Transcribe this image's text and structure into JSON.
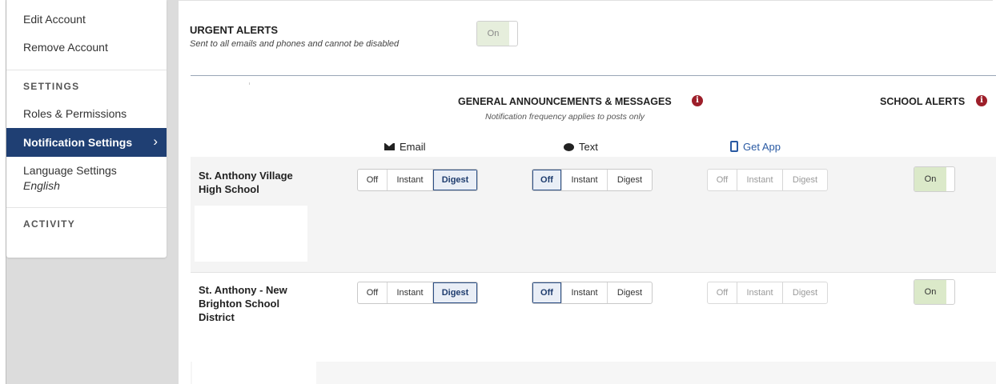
{
  "sidebar": {
    "edit_account": "Edit Account",
    "remove_account": "Remove Account",
    "settings_heading": "SETTINGS",
    "roles": "Roles & Permissions",
    "notification_settings": "Notification Settings",
    "chevron": "›",
    "language_settings": "Language Settings",
    "language_value": "English",
    "activity_heading": "ACTIVITY"
  },
  "urgent": {
    "title": "URGENT ALERTS",
    "subtitle": "Sent to all emails and phones and cannot be disabled",
    "toggle_label": "On"
  },
  "general": {
    "title": "GENERAL ANNOUNCEMENTS & MESSAGES",
    "subtitle": "Notification frequency applies to posts only",
    "info_glyph": "i"
  },
  "school_alerts": {
    "title": "SCHOOL ALERTS",
    "info_glyph": "i"
  },
  "columns": {
    "email": {
      "label": "Email",
      "icon": "envelope-icon"
    },
    "text": {
      "label": "Text",
      "icon": "chat-bubble-icon"
    },
    "app": {
      "label": "Get App",
      "icon": "mobile-phone-icon"
    }
  },
  "options": {
    "off": "Off",
    "instant": "Instant",
    "digest": "Digest",
    "on": "On"
  },
  "schools": [
    {
      "name": "St. Anthony Village High School",
      "email": "Digest",
      "text": "Off",
      "app": "disabled",
      "school_alerts": "On"
    },
    {
      "name": "St. Anthony - New Brighton School District",
      "email": "Digest",
      "text": "Off",
      "app": "disabled",
      "school_alerts": "On"
    }
  ],
  "colors": {
    "nav_active": "#1f3f73",
    "toggle_on": "#dbe9c9",
    "info_icon": "#9d1f2a",
    "link": "#2a5aa3"
  }
}
